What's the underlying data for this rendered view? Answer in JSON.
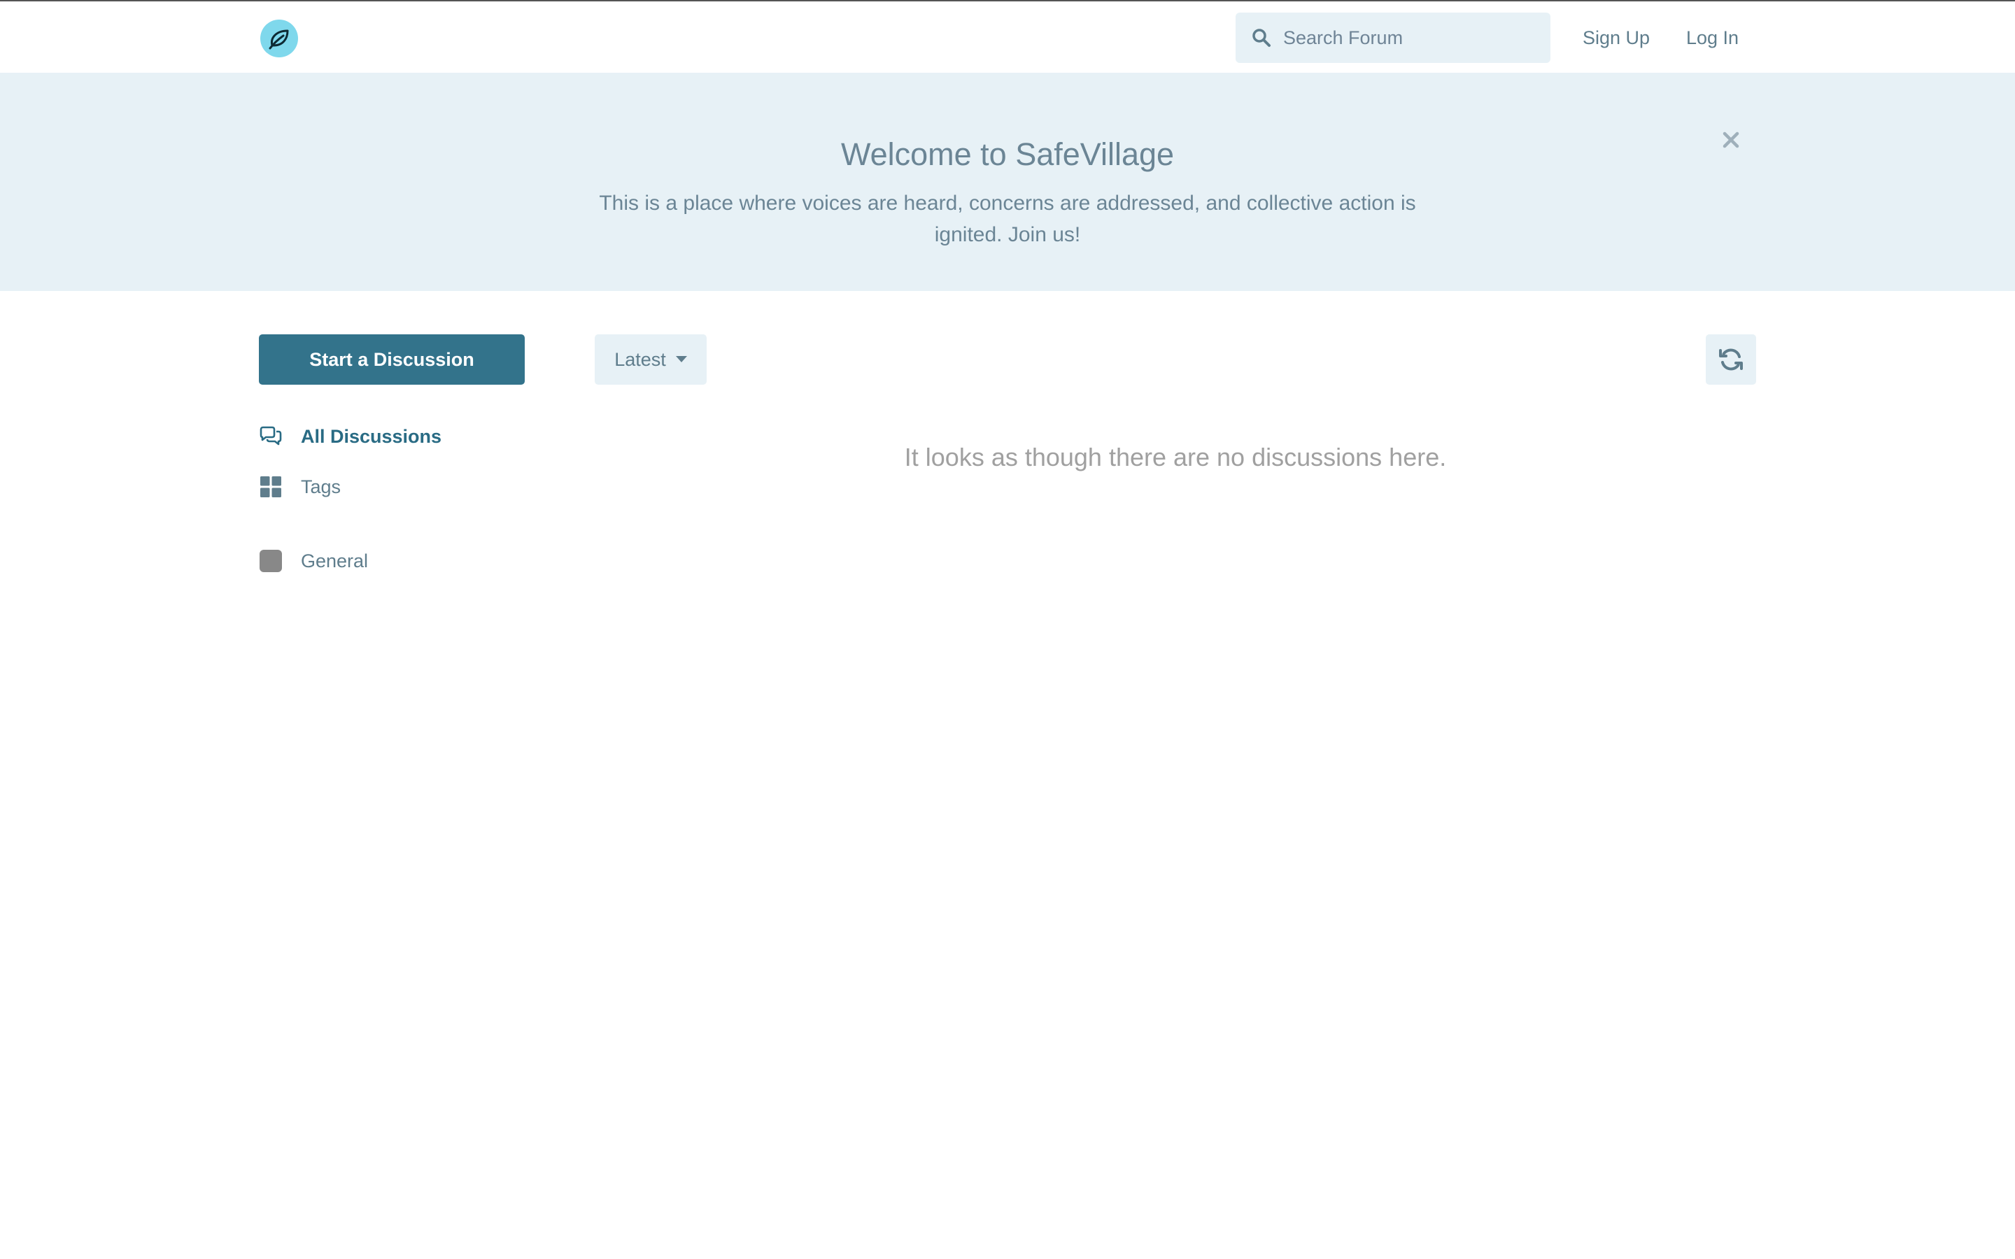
{
  "header": {
    "search_placeholder": "Search Forum",
    "signup_label": "Sign Up",
    "login_label": "Log In"
  },
  "hero": {
    "title": "Welcome to SafeVillage",
    "description": "This is a place where voices are heard, concerns are addressed, and collective action is ignited. Join us!"
  },
  "sidebar": {
    "start_label": "Start a Discussion",
    "items": [
      {
        "label": "All Discussions",
        "icon": "chat-bubbles-icon",
        "active": true
      },
      {
        "label": "Tags",
        "icon": "grid-icon",
        "active": false
      },
      {
        "label": "General",
        "icon": "tag-swatch",
        "color": "#888888",
        "active": false
      }
    ]
  },
  "toolbar": {
    "sort_label": "Latest"
  },
  "main": {
    "empty_message": "It looks as though there are no discussions here."
  },
  "colors": {
    "primary": "#33738b",
    "hero_bg": "#e7f1f6",
    "text": "#5f7d8c",
    "logo_bg": "#7fd8ec"
  }
}
